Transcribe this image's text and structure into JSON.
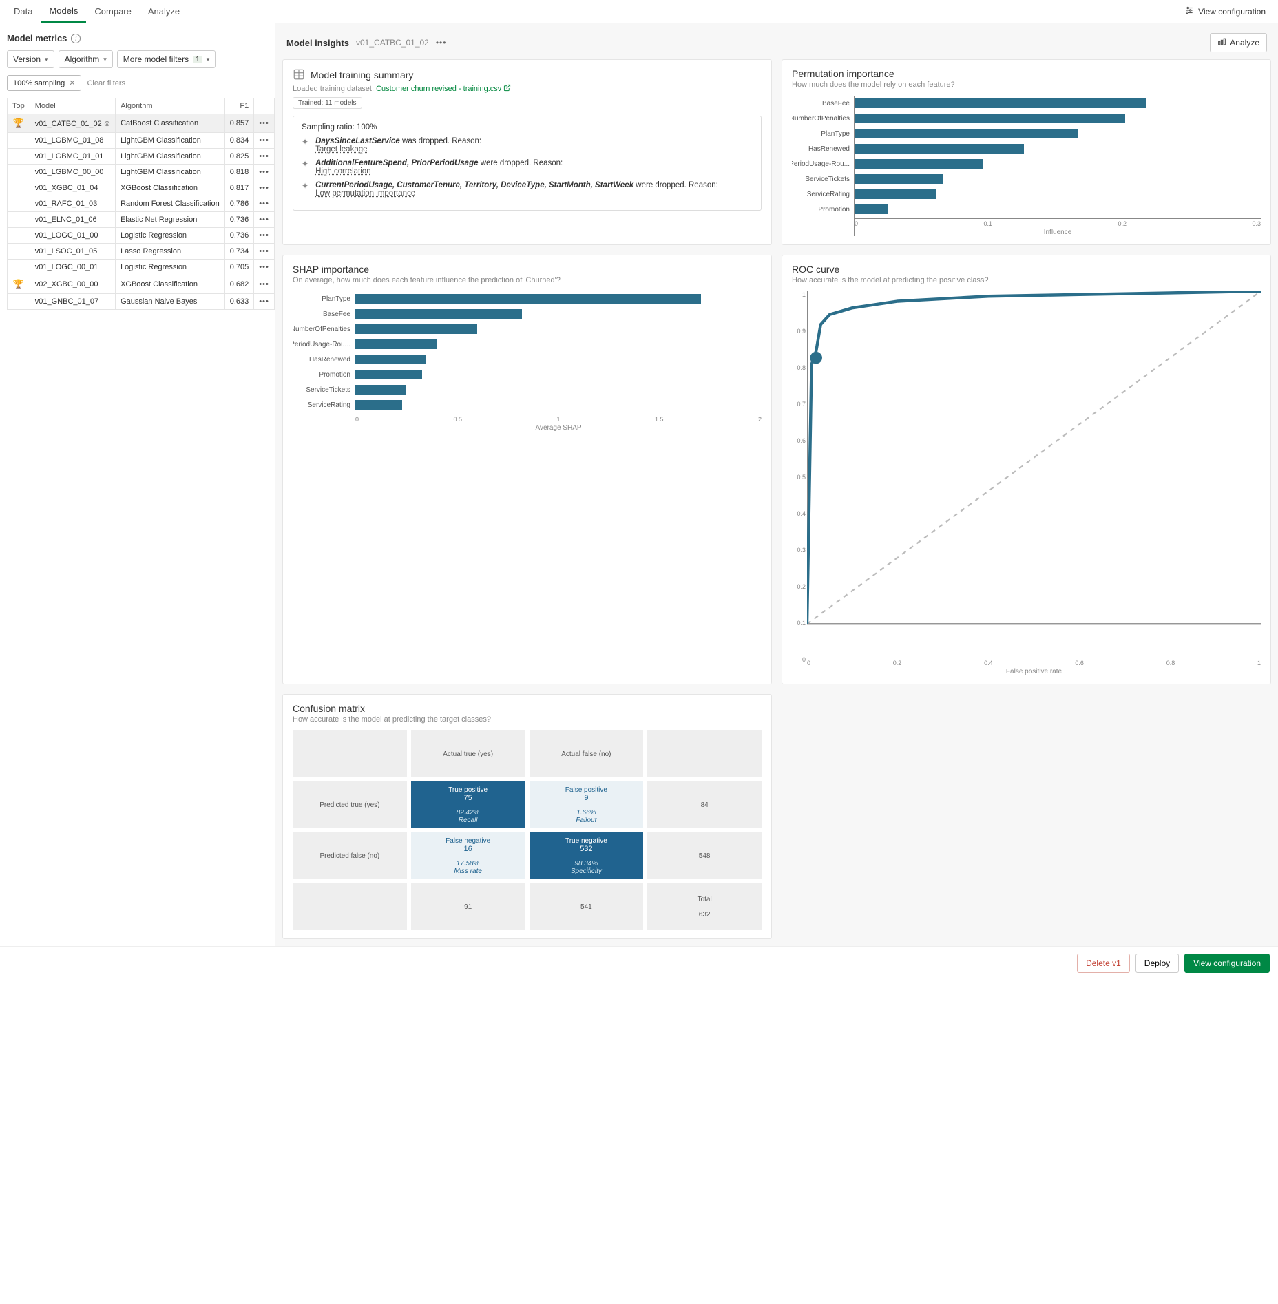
{
  "tabs": {
    "data": "Data",
    "models": "Models",
    "compare": "Compare",
    "analyze": "Analyze",
    "viewConfig": "View configuration"
  },
  "left": {
    "title": "Model metrics",
    "filters": {
      "version": "Version",
      "algorithm": "Algorithm",
      "more": "More model filters",
      "moreBadge": "1"
    },
    "chip": "100% sampling",
    "clear": "Clear filters",
    "columns": {
      "top": "Top",
      "model": "Model",
      "algorithm": "Algorithm",
      "f1": "F1"
    },
    "rows": [
      {
        "top": true,
        "model": "v01_CATBC_01_02",
        "algo": "CatBoost Classification",
        "f1": "0.857",
        "selected": true,
        "pin": true
      },
      {
        "top": false,
        "model": "v01_LGBMC_01_08",
        "algo": "LightGBM Classification",
        "f1": "0.834"
      },
      {
        "top": false,
        "model": "v01_LGBMC_01_01",
        "algo": "LightGBM Classification",
        "f1": "0.825"
      },
      {
        "top": false,
        "model": "v01_LGBMC_00_00",
        "algo": "LightGBM Classification",
        "f1": "0.818"
      },
      {
        "top": false,
        "model": "v01_XGBC_01_04",
        "algo": "XGBoost Classification",
        "f1": "0.817"
      },
      {
        "top": false,
        "model": "v01_RAFC_01_03",
        "algo": "Random Forest Classification",
        "f1": "0.786"
      },
      {
        "top": false,
        "model": "v01_ELNC_01_06",
        "algo": "Elastic Net Regression",
        "f1": "0.736"
      },
      {
        "top": false,
        "model": "v01_LOGC_01_00",
        "algo": "Logistic Regression",
        "f1": "0.736"
      },
      {
        "top": false,
        "model": "v01_LSOC_01_05",
        "algo": "Lasso Regression",
        "f1": "0.734"
      },
      {
        "top": false,
        "model": "v01_LOGC_00_01",
        "algo": "Logistic Regression",
        "f1": "0.705"
      },
      {
        "top": true,
        "model": "v02_XGBC_00_00",
        "algo": "XGBoost Classification",
        "f1": "0.682"
      },
      {
        "top": false,
        "model": "v01_GNBC_01_07",
        "algo": "Gaussian Naive Bayes",
        "f1": "0.633"
      }
    ]
  },
  "insights": {
    "title": "Model insights",
    "current": "v01_CATBC_01_02",
    "analyze": "Analyze",
    "training": {
      "title": "Model training summary",
      "datasetLabel": "Loaded training dataset:",
      "datasetName": "Customer churn revised - training.csv",
      "trained": "Trained: 11 models",
      "sampling": "Sampling ratio:",
      "samplingVal": "100%",
      "drops": [
        {
          "features": "DaysSinceLastService",
          "suffix": " was dropped. Reason: ",
          "reason": "Target leakage"
        },
        {
          "features": "AdditionalFeatureSpend, PriorPeriodUsage",
          "suffix": " were dropped. Reason:",
          "reason": "High correlation"
        },
        {
          "features": "CurrentPeriodUsage, CustomerTenure, Territory, DeviceType, StartMonth, StartWeek",
          "suffix": " were dropped. Reason:",
          "reason": "Low permutation importance"
        }
      ]
    },
    "perm": {
      "title": "Permutation importance",
      "sub": "How much does the model rely on each feature?",
      "xlabel": "Influence"
    },
    "shap": {
      "title": "SHAP importance",
      "sub": "On average, how much does each feature influence the prediction of 'Churned'?",
      "xlabel": "Average SHAP"
    },
    "roc": {
      "title": "ROC curve",
      "sub": "How accurate is the model at predicting the positive class?",
      "xlabel": "False positive rate"
    },
    "cm": {
      "title": "Confusion matrix",
      "sub": "How accurate is the model at predicting the target classes?",
      "labels": {
        "actualTrue": "Actual true (yes)",
        "actualFalse": "Actual false (no)",
        "predTrue": "Predicted true (yes)",
        "predFalse": "Predicted false (no)",
        "total": "Total"
      },
      "cells": {
        "tp": {
          "t": "True positive",
          "v": "75",
          "p": "82.42%",
          "m": "Recall"
        },
        "fp": {
          "t": "False positive",
          "v": "9",
          "p": "1.66%",
          "m": "Fallout"
        },
        "fn": {
          "t": "False negative",
          "v": "16",
          "p": "17.58%",
          "m": "Miss rate"
        },
        "tn": {
          "t": "True negative",
          "v": "532",
          "p": "98.34%",
          "m": "Specificity"
        },
        "rowTrue": "84",
        "rowFalse": "548",
        "colTrue": "91",
        "colFalse": "541",
        "total": "632"
      }
    }
  },
  "footer": {
    "delete": "Delete v1",
    "deploy": "Deploy",
    "viewConfig": "View configuration"
  },
  "chart_data": [
    {
      "type": "bar",
      "orientation": "horizontal",
      "name": "permutation",
      "categories": [
        "BaseFee",
        "NumberOfPenalties",
        "PlanType",
        "HasRenewed",
        "PriorPeriodUsage-Rou...",
        "ServiceTickets",
        "ServiceRating",
        "Promotion"
      ],
      "values": [
        0.215,
        0.2,
        0.165,
        0.125,
        0.095,
        0.065,
        0.06,
        0.025
      ],
      "xlabel": "Influence",
      "xlim": [
        0,
        0.3
      ],
      "xticks": [
        0,
        0.1,
        0.2,
        0.3
      ]
    },
    {
      "type": "bar",
      "orientation": "horizontal",
      "name": "shap",
      "categories": [
        "PlanType",
        "BaseFee",
        "NumberOfPenalties",
        "PriorPeriodUsage-Rou...",
        "HasRenewed",
        "Promotion",
        "ServiceTickets",
        "ServiceRating"
      ],
      "values": [
        1.7,
        0.82,
        0.6,
        0.4,
        0.35,
        0.33,
        0.25,
        0.23
      ],
      "xlabel": "Average SHAP",
      "xlim": [
        0,
        2
      ],
      "xticks": [
        0,
        0.5,
        1,
        1.5,
        2
      ]
    },
    {
      "type": "line",
      "name": "roc",
      "x": [
        0,
        0.01,
        0.02,
        0.03,
        0.05,
        0.1,
        0.2,
        0.4,
        0.6,
        0.8,
        1.0
      ],
      "series": [
        {
          "name": "ROC",
          "values": [
            0,
            0.78,
            0.82,
            0.9,
            0.93,
            0.95,
            0.97,
            0.985,
            0.99,
            0.995,
            1.0
          ]
        },
        {
          "name": "Chance",
          "values": [
            0,
            0.01,
            0.02,
            0.03,
            0.05,
            0.1,
            0.2,
            0.4,
            0.6,
            0.8,
            1.0
          ]
        }
      ],
      "xlabel": "False positive rate",
      "xlim": [
        0,
        1
      ],
      "ylim": [
        0,
        1
      ],
      "xticks": [
        0,
        0.2,
        0.4,
        0.6,
        0.8,
        1
      ],
      "yticks": [
        0,
        0.1,
        0.2,
        0.3,
        0.4,
        0.5,
        0.6,
        0.7,
        0.8,
        0.9,
        1
      ]
    }
  ]
}
